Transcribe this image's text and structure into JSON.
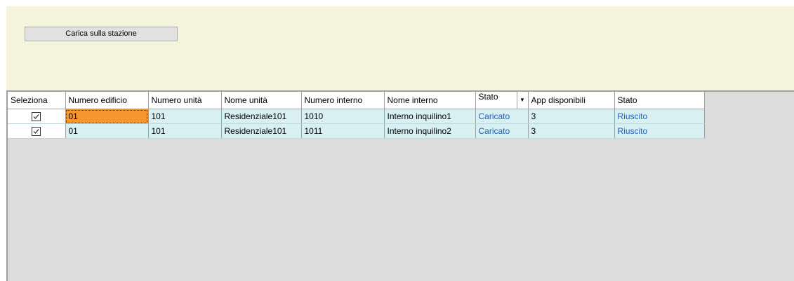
{
  "toolbar": {
    "load_button_label": "Carica sulla stazione"
  },
  "grid": {
    "columns": [
      "Seleziona",
      "Numero edificio",
      "Numero unità",
      "Nome unità",
      "Numero interno",
      "Nome interno",
      "Stato",
      "App disponibili",
      "Stato"
    ],
    "rows": [
      {
        "selected": true,
        "numero_edificio": "01",
        "numero_unita": "101",
        "nome_unita": "Residenziale101",
        "numero_interno": "1010",
        "nome_interno": "Interno inquilino1",
        "stato": "Caricato",
        "app_disponibili": "3",
        "stato_esito": "Riuscito"
      },
      {
        "selected": true,
        "numero_edificio": "01",
        "numero_unita": "101",
        "nome_unita": "Residenziale101",
        "numero_interno": "1011",
        "nome_interno": "Interno inquilino2",
        "stato": "Caricato",
        "app_disponibili": "3",
        "stato_esito": "Riuscito"
      }
    ]
  },
  "colors": {
    "top_panel_bg": "#f4f5dc",
    "row_bg": "#d9f0f3",
    "selected_cell_bg": "#f5962f",
    "link_text": "#1f5fb4",
    "empty_area_bg": "#dcdcdc"
  },
  "icons": {
    "checkbox": "checkmark-icon",
    "sort": "sort-down-icon"
  }
}
